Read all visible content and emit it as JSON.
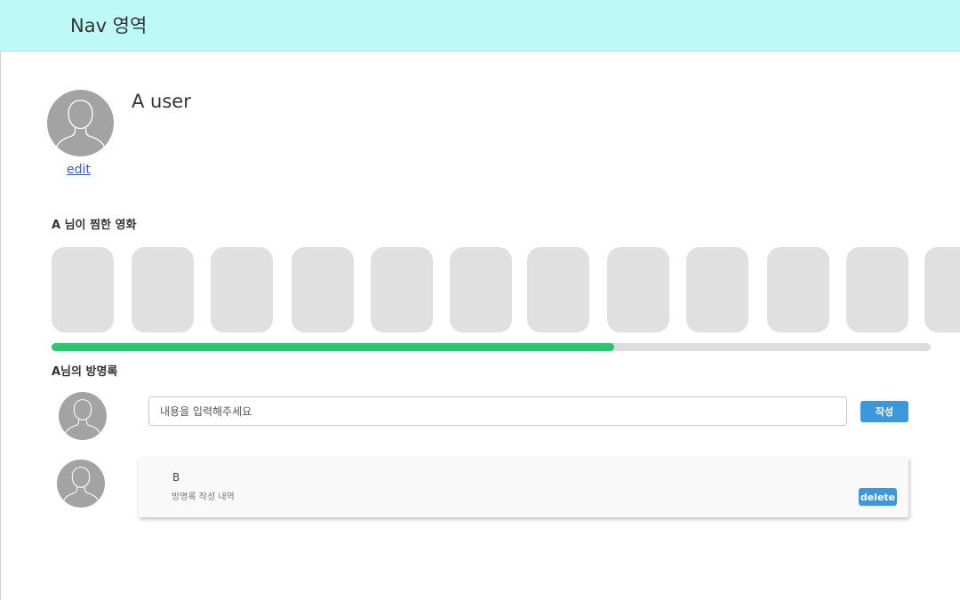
{
  "nav": {
    "title": "Nav 영역"
  },
  "profile": {
    "username": "A user",
    "edit_label": "edit",
    "avatar_icon": "user-silhouette-icon"
  },
  "favorites": {
    "title": "A 님이 찜한 영화",
    "card_count": 12,
    "scroll_progress_percent": 64,
    "scroll_color": "#2ec66c"
  },
  "guestbook": {
    "title": "A님의 방명록",
    "input_placeholder": "내용을 입력해주세요",
    "submit_label": "작성",
    "entries": [
      {
        "author": "B",
        "content": "방명록 작성 내역",
        "delete_label": "delete"
      }
    ]
  },
  "colors": {
    "nav_bg": "#bdf9f6",
    "button": "#3d98db",
    "avatar": "#a3a3a3",
    "card": "#e0e0e0"
  }
}
